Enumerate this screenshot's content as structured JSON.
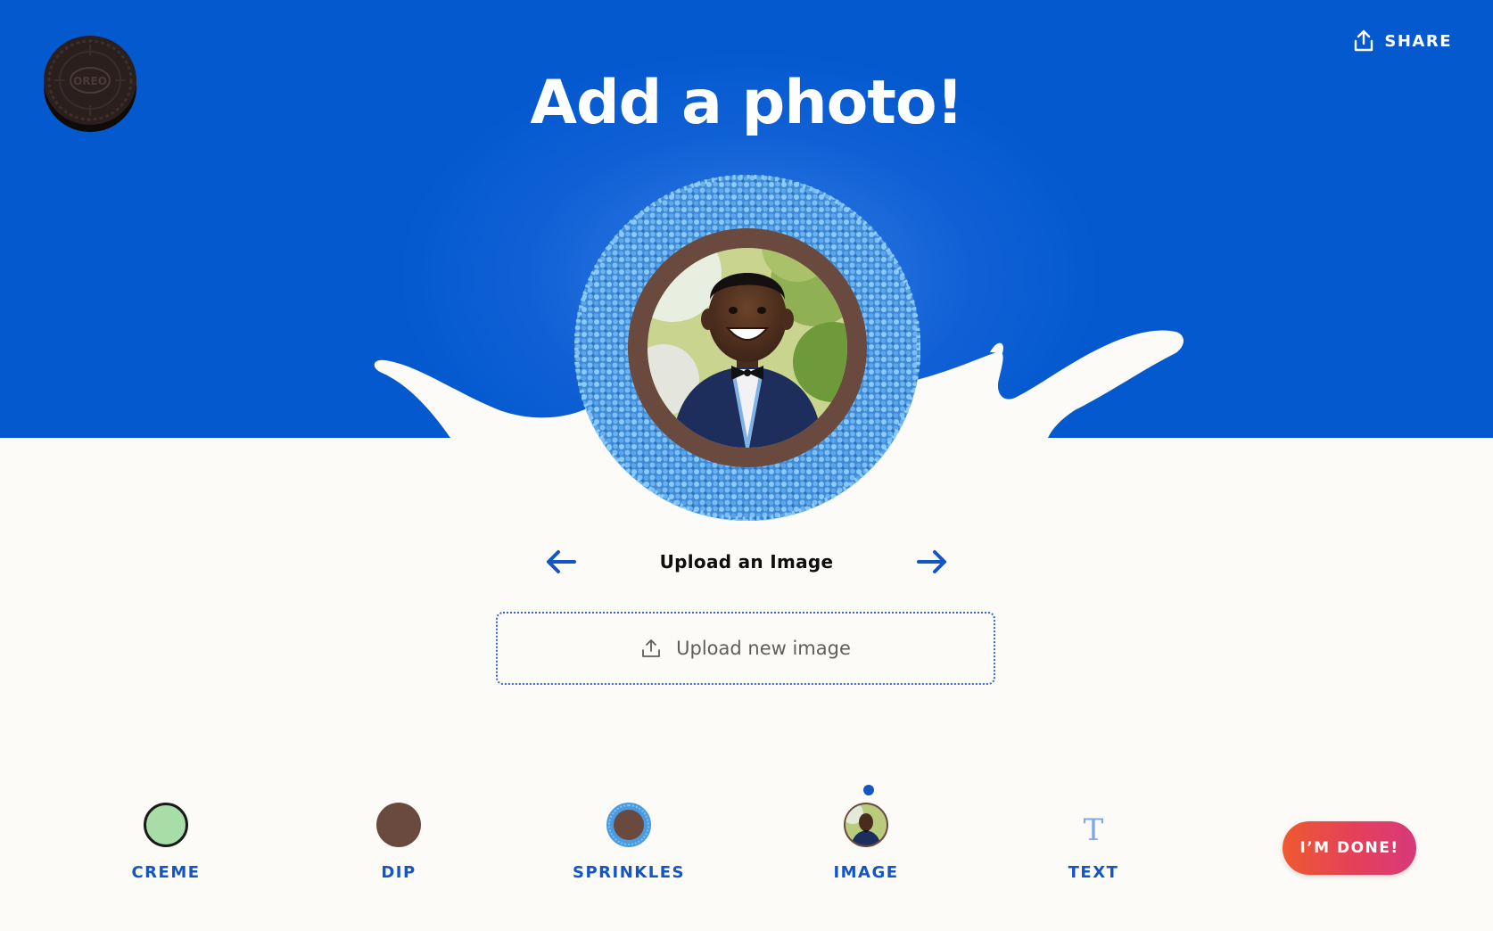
{
  "header": {
    "title": "Add a photo!",
    "share_label": "SHARE",
    "logo_icon": "oreo-cookie-logo"
  },
  "colors": {
    "hero_background": "#0459CF",
    "page_background": "#FDFBF7",
    "accent_blue": "#1455C4",
    "sprinkle_blue": "#4A9BE0",
    "dip_brown": "#6A4A3E",
    "creme_green": "#A8DDA8",
    "done_gradient": [
      "#EE5A30",
      "#D8397A"
    ]
  },
  "preview": {
    "image_alt": "Smiling child in navy cardigan and bow tie"
  },
  "step_nav": {
    "label": "Upload an Image",
    "prev_icon": "arrow-left-icon",
    "next_icon": "arrow-right-icon"
  },
  "upload": {
    "label": "Upload new image",
    "icon": "upload-icon"
  },
  "toolbar": {
    "active": "IMAGE",
    "items": [
      {
        "label": "CREME",
        "icon": "creme-swatch-icon"
      },
      {
        "label": "DIP",
        "icon": "dip-swatch-icon"
      },
      {
        "label": "SPRINKLES",
        "icon": "sprinkles-swatch-icon"
      },
      {
        "label": "IMAGE",
        "icon": "image-thumbnail-icon"
      },
      {
        "label": "TEXT",
        "icon": "text-icon",
        "glyph": "T"
      }
    ]
  },
  "done_button": {
    "label": "I’M DONE!"
  }
}
